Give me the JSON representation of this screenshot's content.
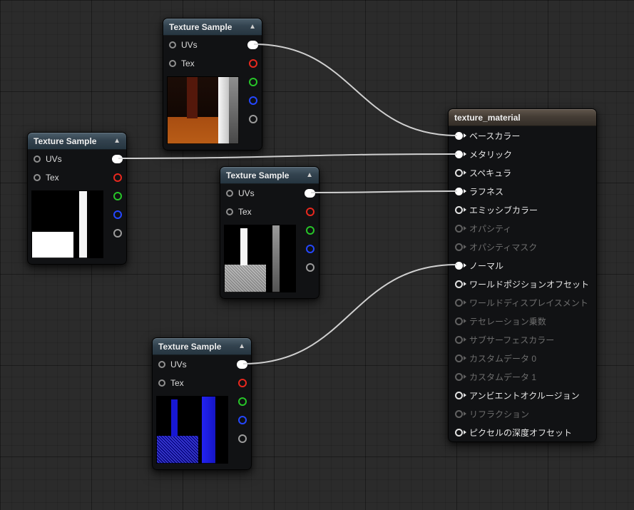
{
  "ui": {
    "collapse_icon": "▲"
  },
  "pin_colors": {
    "rgb": "#ffffff",
    "r": "#e8281e",
    "g": "#27c528",
    "b": "#2447ff",
    "a": "#9b9b9b",
    "input": "#8f8f8f"
  },
  "texture_samples": [
    {
      "title": "Texture Sample",
      "inputs": {
        "uvs": "UVs",
        "tex": "Tex"
      }
    },
    {
      "title": "Texture Sample",
      "inputs": {
        "uvs": "UVs",
        "tex": "Tex"
      }
    },
    {
      "title": "Texture Sample",
      "inputs": {
        "uvs": "UVs",
        "tex": "Tex"
      }
    },
    {
      "title": "Texture Sample",
      "inputs": {
        "uvs": "UVs",
        "tex": "Tex"
      }
    }
  ],
  "material": {
    "title": "texture_material",
    "pins": [
      {
        "label": "ベースカラー",
        "state": "connected"
      },
      {
        "label": "メタリック",
        "state": "connected"
      },
      {
        "label": "スペキュラ",
        "state": "open"
      },
      {
        "label": "ラフネス",
        "state": "connected"
      },
      {
        "label": "エミッシブカラー",
        "state": "open"
      },
      {
        "label": "オパシティ",
        "state": "disabled"
      },
      {
        "label": "オパシティマスク",
        "state": "disabled"
      },
      {
        "label": "ノーマル",
        "state": "connected"
      },
      {
        "label": "ワールドポジションオフセット",
        "state": "open"
      },
      {
        "label": "ワールドディスプレイスメント",
        "state": "disabled"
      },
      {
        "label": "テセレーション乗数",
        "state": "disabled"
      },
      {
        "label": "サブサーフェスカラー",
        "state": "disabled"
      },
      {
        "label": "カスタムデータ 0",
        "state": "disabled"
      },
      {
        "label": "カスタムデータ 1",
        "state": "disabled"
      },
      {
        "label": "アンビエントオクルージョン",
        "state": "open"
      },
      {
        "label": "リフラクション",
        "state": "disabled"
      },
      {
        "label": "ピクセルの深度オフセット",
        "state": "open"
      }
    ]
  },
  "connections": [
    {
      "from": "texture-sample-top.RGB",
      "to": "ベースカラー"
    },
    {
      "from": "texture-sample-left.RGB",
      "to": "メタリック"
    },
    {
      "from": "texture-sample-middle.RGB",
      "to": "ラフネス"
    },
    {
      "from": "texture-sample-bottom.RGB",
      "to": "ノーマル"
    }
  ]
}
